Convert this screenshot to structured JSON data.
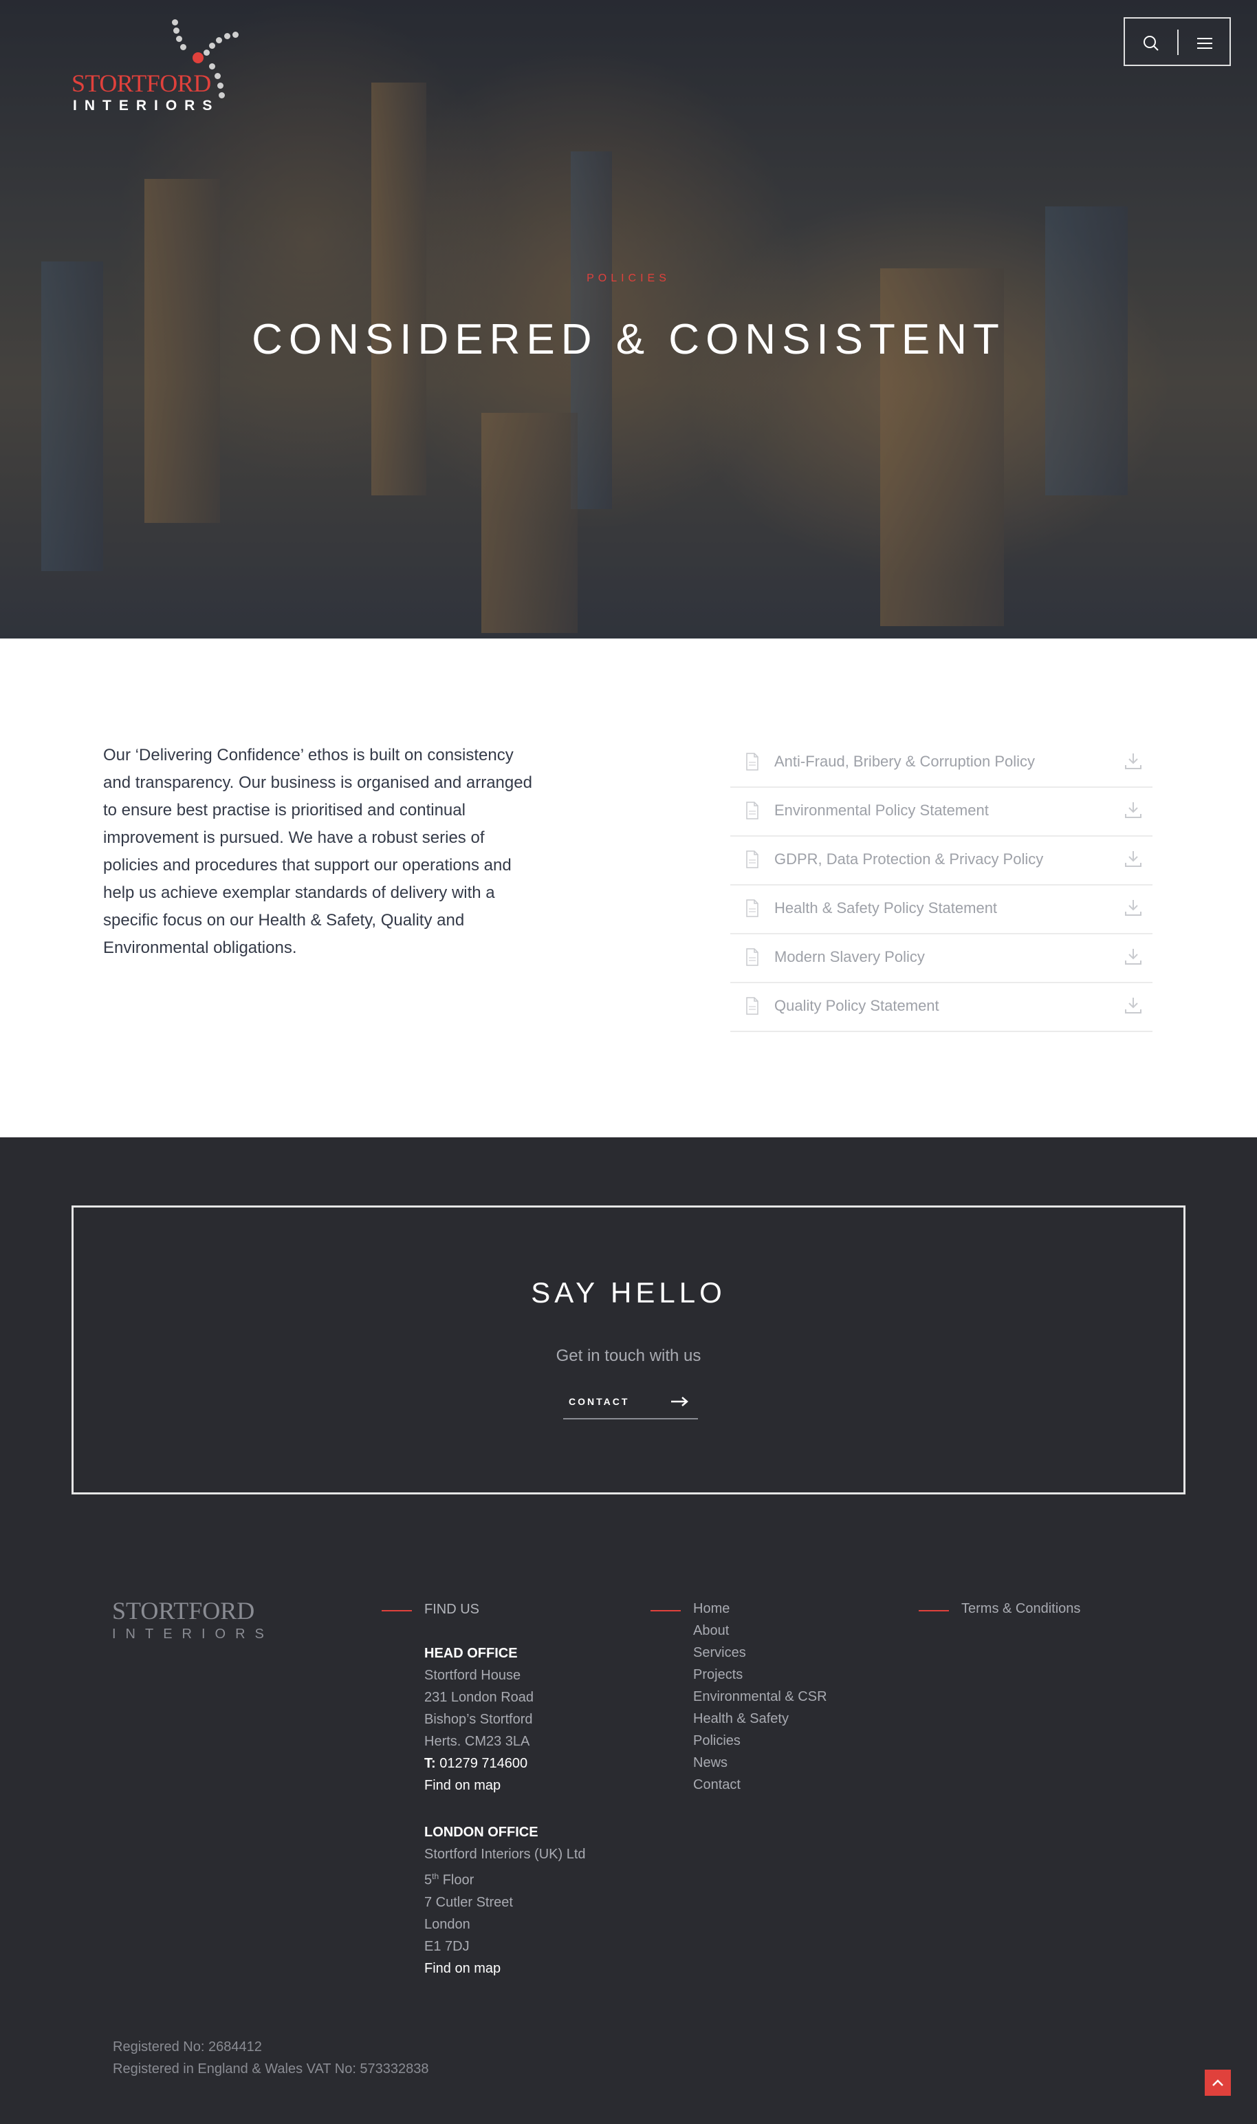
{
  "brand": {
    "logo_line1": "STORTFORD",
    "logo_line2": "INTERIORS",
    "accent_color": "#e0413c"
  },
  "header": {
    "search_icon": "search-icon",
    "menu_icon": "hamburger-menu-icon"
  },
  "hero": {
    "eyebrow": "POLICIES",
    "title": "CONSIDERED & CONSISTENT"
  },
  "intro": {
    "text": "Our ‘Delivering Confidence’ ethos is built on consistency and transparency. Our business is organised and arranged to ensure best practise is prioritised and continual improvement is pursued. We have a robust series of policies and procedures that support our operations and help us achieve exemplar standards of delivery with a specific focus on our Health & Safety, Quality and Environmental obligations."
  },
  "policies": [
    {
      "label": "Anti-Fraud, Bribery & Corruption Policy"
    },
    {
      "label": "Environmental Policy Statement"
    },
    {
      "label": "GDPR, Data Protection & Privacy Policy"
    },
    {
      "label": "Health & Safety Policy Statement"
    },
    {
      "label": "Modern Slavery Policy"
    },
    {
      "label": "Quality Policy Statement"
    }
  ],
  "say_hello": {
    "title": "SAY HELLO",
    "subtitle": "Get in touch with us",
    "cta_label": "CONTACT"
  },
  "footer": {
    "logo_line1": "STORTFORD",
    "logo_line2": "INTERIORS",
    "find_us": {
      "heading": "FIND US",
      "head_office": {
        "title": "HEAD OFFICE",
        "lines": [
          "Stortford House",
          "231 London Road",
          "Bishop’s Stortford",
          "Herts. CM23 3LA"
        ],
        "phone_label": "T:",
        "phone": "01279 714600",
        "map_link": "Find on map"
      },
      "london_office": {
        "title": "LONDON OFFICE",
        "company": "Stortford Interiors (UK) Ltd",
        "floor_num": "5",
        "floor_sup": "th",
        "floor_word": "Floor",
        "lines": [
          "7 Cutler Street",
          "London",
          "E1 7DJ"
        ],
        "map_link": "Find on map"
      }
    },
    "menu": [
      "Home",
      "About",
      "Services",
      "Projects",
      "Environmental & CSR",
      "Health & Safety",
      "Policies",
      "News",
      "Contact"
    ],
    "legal": [
      "Terms & Conditions"
    ],
    "registered": "Registered No: 2684412",
    "vat": "Registered in England & Wales VAT No: 573332838"
  }
}
